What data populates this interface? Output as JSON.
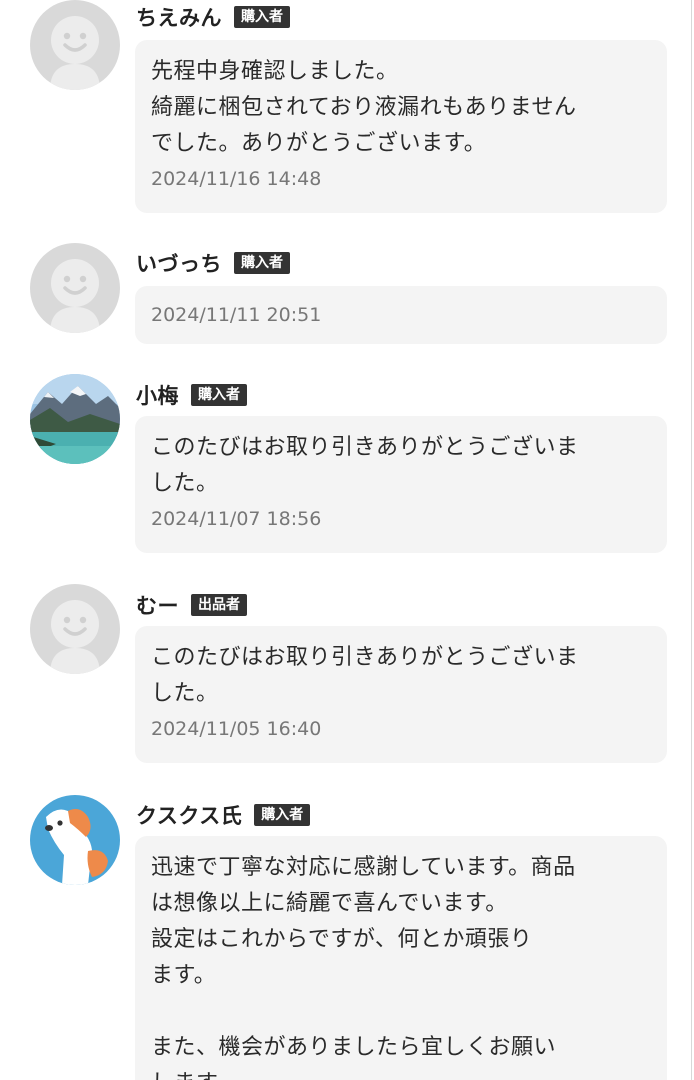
{
  "comments": [
    {
      "name": "ちえみん",
      "role": "購入者",
      "avatar": "default-face-icon",
      "message": "先程中身確認しました。\n綺麗に梱包されており液漏れもありません\nでした。ありがとうございます。",
      "time": "2024/11/16 14:48"
    },
    {
      "name": "いづっち",
      "role": "購入者",
      "avatar": "default-face-icon",
      "message": "",
      "time": "2024/11/11 20:51"
    },
    {
      "name": "小梅",
      "role": "購入者",
      "avatar": "mountain-lake-photo",
      "message": "このたびはお取り引きありがとうございま\nした。",
      "time": "2024/11/07 18:56"
    },
    {
      "name": "むー",
      "role": "出品者",
      "avatar": "default-face-icon",
      "message": "このたびはお取り引きありがとうございま\nした。",
      "time": "2024/11/05 16:40"
    },
    {
      "name": "クスクス氏",
      "role": "購入者",
      "avatar": "dog-illustration",
      "message": "迅速で丁寧な対応に感謝しています。商品\nは想像以上に綺麗で喜んでいます。\n設定はこれからですが、何とか頑張り\nます。\n\nまた、機会がありましたら宜しくお願い\nします。",
      "time": ""
    }
  ],
  "colors": {
    "bubble": "#f4f4f4",
    "badge": "#333333",
    "avatar_bg": "#d9d9d9",
    "avatar_face": "#ececec"
  }
}
